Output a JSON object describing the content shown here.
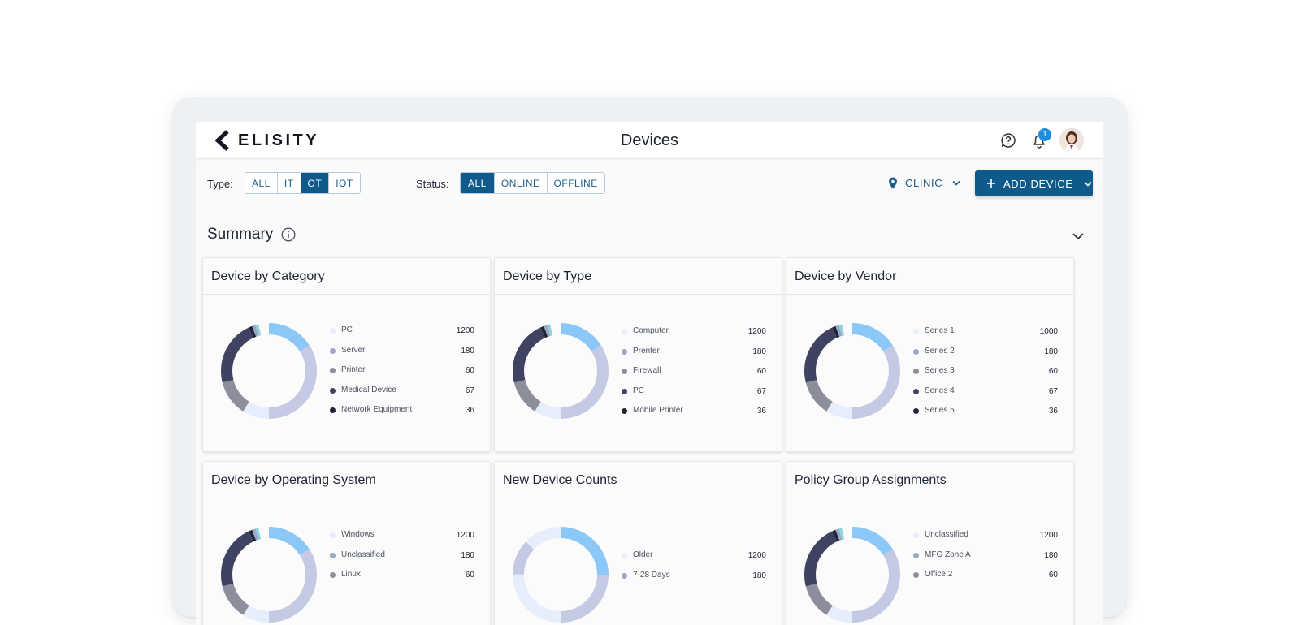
{
  "header": {
    "logo_text": "ELISITY",
    "title": "Devices",
    "notification_count": "1"
  },
  "filters": {
    "type_label": "Type:",
    "type_options": [
      "ALL",
      "IT",
      "OT",
      "IOT"
    ],
    "type_selected": "OT",
    "status_label": "Status:",
    "status_options": [
      "ALL",
      "ONLINE",
      "OFFLINE"
    ],
    "status_selected": "ALL",
    "location": "CLINIC",
    "add_label": "ADD DEVICE"
  },
  "summary": {
    "title": "Summary"
  },
  "colors": {
    "series": [
      "#e6eefb",
      "#9ba7c9",
      "#8c8e9b",
      "#3f4260",
      "#1f2536"
    ],
    "accent_blue": "#8cc8f7",
    "lavender": "#c4c9e4",
    "primary": "#0e5a8a"
  },
  "cards": [
    {
      "title": "Device by Category",
      "legend": [
        {
          "label": "PC",
          "value": "1200"
        },
        {
          "label": "Server",
          "value": "180"
        },
        {
          "label": "Printer",
          "value": "60"
        },
        {
          "label": "Medical Device",
          "value": "67"
        },
        {
          "label": "Network Equipment",
          "value": "36"
        }
      ]
    },
    {
      "title": "Device by Type",
      "legend": [
        {
          "label": "Computer",
          "value": "1200"
        },
        {
          "label": "Prenter",
          "value": "180"
        },
        {
          "label": "Firewall",
          "value": "60"
        },
        {
          "label": "PC",
          "value": "67"
        },
        {
          "label": "Mobile Printer",
          "value": "36"
        }
      ]
    },
    {
      "title": "Device by Vendor",
      "legend": [
        {
          "label": "Series 1",
          "value": "1000"
        },
        {
          "label": "Series 2",
          "value": "180"
        },
        {
          "label": "Series 3",
          "value": "60"
        },
        {
          "label": "Series 4",
          "value": "67"
        },
        {
          "label": "Series 5",
          "value": "36"
        }
      ]
    },
    {
      "title": "Device by Operating System",
      "legend": [
        {
          "label": "Windows",
          "value": "1200"
        },
        {
          "label": "Unclassified",
          "value": "180"
        },
        {
          "label": "Linux",
          "value": "60"
        }
      ]
    },
    {
      "title": "New Device Counts",
      "legend": [
        {
          "label": "Older",
          "value": "1200"
        },
        {
          "label": "7-28 Days",
          "value": "180"
        }
      ]
    },
    {
      "title": "Policy Group Assignments",
      "legend": [
        {
          "label": "Unclassified",
          "value": "1200"
        },
        {
          "label": "MFG Zone A",
          "value": "180"
        },
        {
          "label": "Office 2",
          "value": "60"
        }
      ]
    }
  ]
}
